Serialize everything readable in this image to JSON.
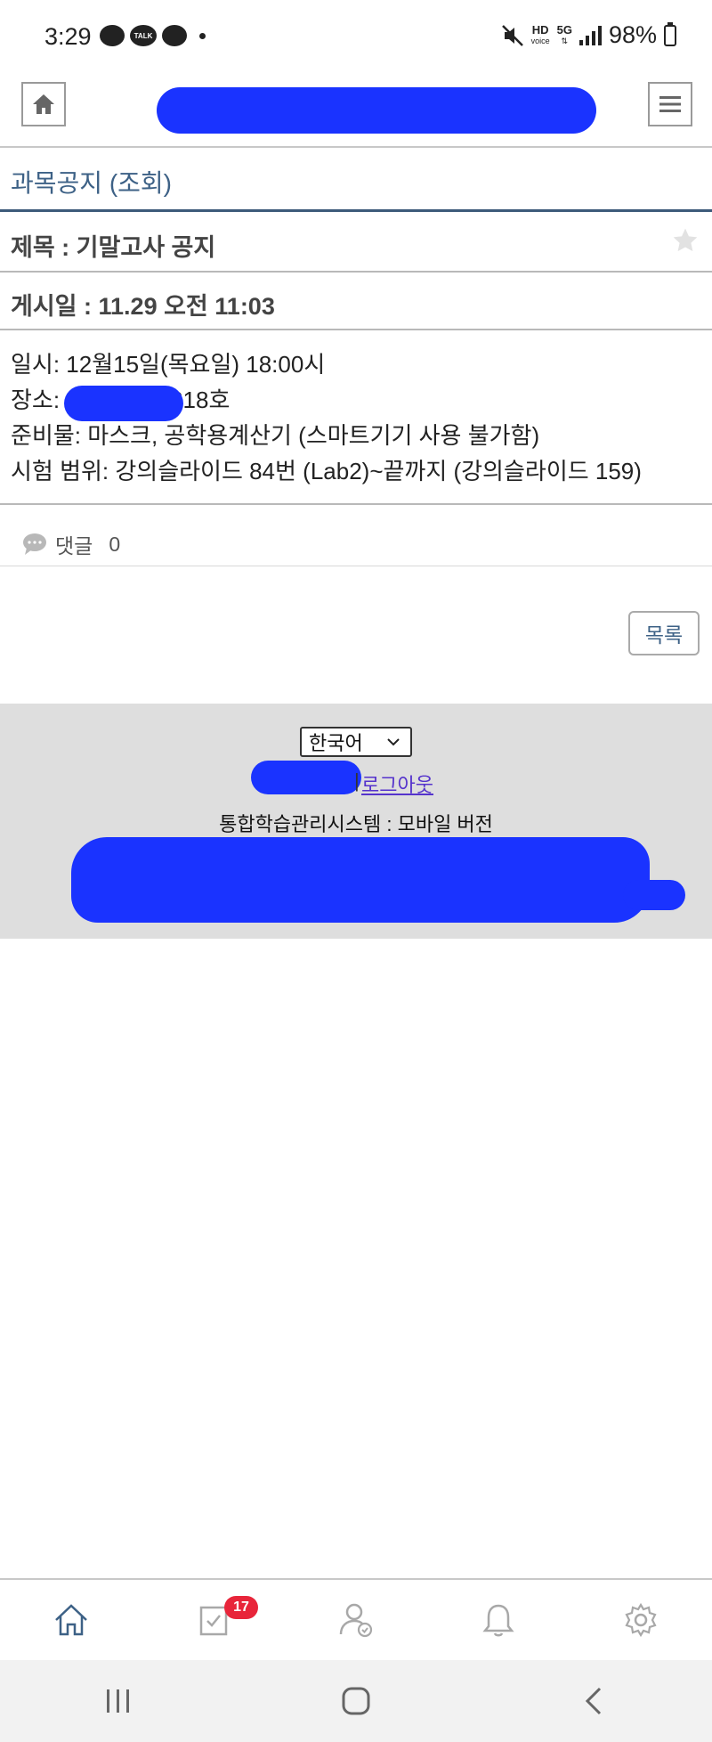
{
  "status_bar": {
    "time": "3:29",
    "talk_label": "TALK",
    "hd_label": "HD",
    "voice_label": "voice",
    "network_label": "5G",
    "battery": "98%"
  },
  "header": {
    "home_icon": "home-icon",
    "menu_icon": "hamburger-menu-icon"
  },
  "page": {
    "title": "과목공지 (조회)",
    "subject": "제목 : 기말고사 공지",
    "posted": "게시일 : 11.29 오전 11:03",
    "body_lines": [
      "일시: 12월15일(목요일) 18:00시",
      "장소:",
      "318호",
      "준비물: 마스크, 공학용계산기  (스마트기기 사용 불가함)",
      "시험 범위: 강의슬라이드 84번 (Lab2)~끝까지 (강의슬라이드 159)"
    ],
    "comments_label": "댓글",
    "comments_count": "0",
    "list_button": "목록"
  },
  "footer": {
    "language_selected": "한국어",
    "separator": "|",
    "logout_label": "로그아웃",
    "system_name": "통합학습관리시스템 : 모바일 버전"
  },
  "bottom_nav": {
    "items": [
      "home-icon",
      "todo-icon",
      "profile-icon",
      "bell-icon",
      "settings-icon"
    ],
    "todo_badge": "17"
  },
  "colors": {
    "accent": "#3d6186",
    "redaction": "#1a33ff",
    "badge": "#e8253a",
    "footer_bg": "#dedede"
  }
}
